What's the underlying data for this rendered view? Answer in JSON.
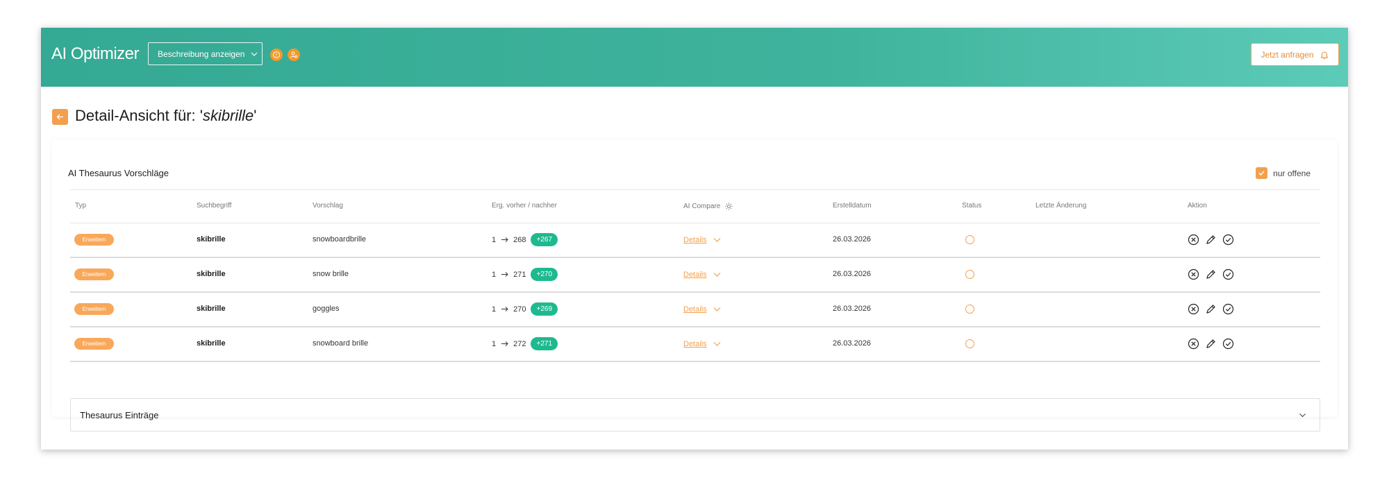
{
  "header": {
    "app_title": "AI Optimizer",
    "description_button": "Beschreibung anzeigen",
    "request_button": "Jetzt anfragen"
  },
  "page": {
    "title_prefix": "Detail-Ansicht für: '",
    "title_term": "skibrille",
    "title_suffix": "'"
  },
  "suggestions": {
    "title": "AI Thesaurus Vorschläge",
    "filter_label": "nur offene",
    "filter_checked": true,
    "columns": [
      "Typ",
      "Suchbegriff",
      "Vorschlag",
      "Erg. vorher / nachher",
      "AI Compare",
      "Erstelldatum",
      "Status",
      "Letzte Änderung",
      "Aktion"
    ],
    "rows": [
      {
        "type": "Erweitern",
        "term": "skibrille",
        "suggestion": "snowboardbrille",
        "before": "1",
        "after": "268",
        "delta": "+267",
        "details": "Details",
        "created": "26.03.2026",
        "status": "offen",
        "last_change": ""
      },
      {
        "type": "Erweitern",
        "term": "skibrille",
        "suggestion": "snow brille",
        "before": "1",
        "after": "271",
        "delta": "+270",
        "details": "Details",
        "created": "26.03.2026",
        "status": "offen",
        "last_change": ""
      },
      {
        "type": "Erweitern",
        "term": "skibrille",
        "suggestion": "goggles",
        "before": "1",
        "after": "270",
        "delta": "+269",
        "details": "Details",
        "created": "26.03.2026",
        "status": "offen",
        "last_change": ""
      },
      {
        "type": "Erweitern",
        "term": "skibrille",
        "suggestion": "snowboard brille",
        "before": "1",
        "after": "272",
        "delta": "+271",
        "details": "Details",
        "created": "26.03.2026",
        "status": "offen",
        "last_change": ""
      }
    ]
  },
  "thesaurus_entries": {
    "title": "Thesaurus Einträge"
  },
  "colors": {
    "header_gradient_start": "#34a993",
    "header_gradient_end": "#5ccbb8",
    "accent_orange": "#f2a04e",
    "delta_green": "#1dba8f"
  },
  "icons": [
    "info-icon",
    "user-settings-icon",
    "bell-icon",
    "arrow-left-icon",
    "check-icon",
    "arrow-right-icon",
    "chevron-down-icon",
    "gear-icon",
    "reject-icon",
    "edit-icon",
    "accept-icon"
  ]
}
